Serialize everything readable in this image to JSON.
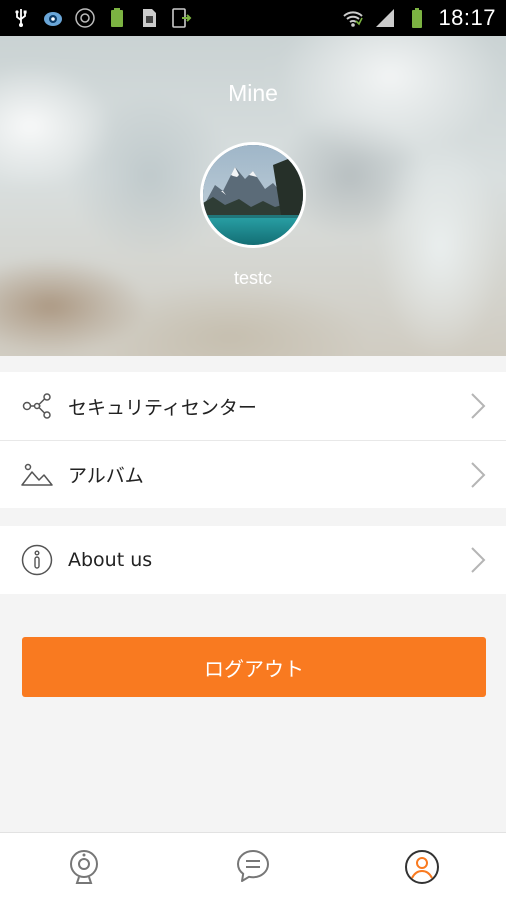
{
  "status_bar": {
    "time": "18:17",
    "icons": [
      "usb-icon",
      "app-notification-icon",
      "camera-icon",
      "battery-charging-small-icon",
      "sim-card-icon",
      "screenshot-icon",
      "wifi-icon",
      "signal-icon",
      "battery-icon"
    ]
  },
  "header": {
    "title": "Mine",
    "username": "testc"
  },
  "menu": {
    "security_center": "セキュリティセンター",
    "album": "アルバム",
    "about_us": "About us"
  },
  "logout_label": "ログアウト",
  "tabbar": {
    "tabs": [
      "camera-tab-icon",
      "message-tab-icon",
      "profile-tab-icon"
    ],
    "active_index": 2
  },
  "colors": {
    "accent": "#f97a20",
    "background": "#f4f4f4",
    "active_tab": "#f97a20",
    "inactive_icon": "#777777"
  }
}
